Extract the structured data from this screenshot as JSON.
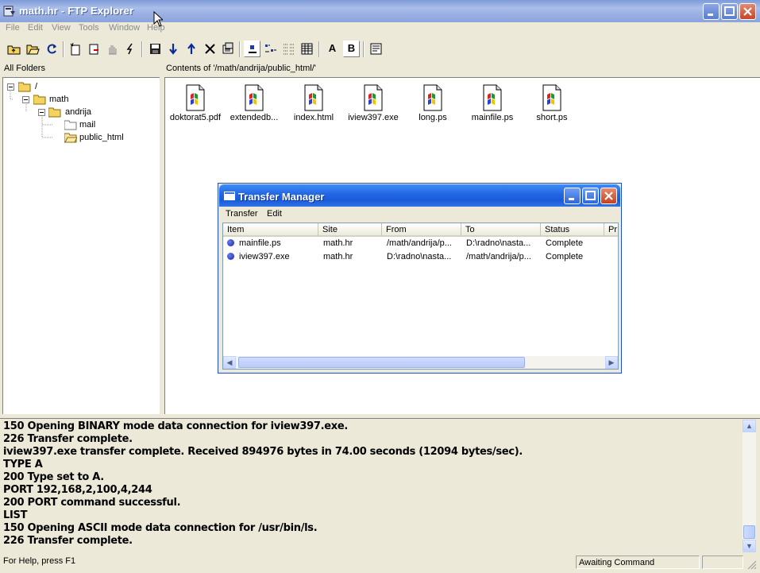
{
  "window": {
    "title": "math.hr - FTP Explorer",
    "controls": [
      "minimize",
      "maximize",
      "close"
    ]
  },
  "menubar": [
    "File",
    "Edit",
    "View",
    "Tools",
    "Window",
    "Help"
  ],
  "toolbar": {
    "buttons": [
      "up-folder-icon",
      "open-folder-icon",
      "refresh-icon",
      "new-folder-icon",
      "delete-file-icon",
      "hand-icon",
      "connect-icon",
      "save-icon",
      "download-icon",
      "upload-icon",
      "delete-icon",
      "properties-icon",
      "large-icons-view-icon",
      "small-icons-view-icon",
      "list-view-icon",
      "details-view-icon",
      "ascii-mode-icon",
      "binary-mode-icon",
      "log-window-icon"
    ],
    "ascii_label": "A",
    "binary_label": "B"
  },
  "folders_pane": {
    "header": "All Folders",
    "tree": [
      {
        "label": "/",
        "level": 0
      },
      {
        "label": "math",
        "level": 1
      },
      {
        "label": "andrija",
        "level": 2
      },
      {
        "label": "mail",
        "level": 3
      },
      {
        "label": "public_html",
        "level": 3
      }
    ]
  },
  "contents_pane": {
    "header": "Contents of '/math/andrija/public_html/'",
    "files": [
      "doktorat5.pdf",
      "extendedb...",
      "index.html",
      "iview397.exe",
      "long.ps",
      "mainfile.ps",
      "short.ps"
    ]
  },
  "transfer_manager": {
    "title": "Transfer Manager",
    "menu": [
      "Transfer",
      "Edit"
    ],
    "columns": [
      "Item",
      "Site",
      "From",
      "To",
      "Status",
      "Pr"
    ],
    "rows": [
      [
        "mainfile.ps",
        "math.hr",
        "/math/andrija/p...",
        "D:\\radno\\nasta...",
        "Complete"
      ],
      [
        "iview397.exe",
        "math.hr",
        "D:\\radno\\nasta...",
        "/math/andrija/p...",
        "Complete"
      ]
    ]
  },
  "log": [
    "150 Opening BINARY mode data connection for iview397.exe.",
    "226 Transfer complete.",
    "iview397.exe transfer complete.  Received 894976 bytes in 74.00 seconds (12094 bytes/sec).",
    "TYPE A",
    "200 Type set to A.",
    "PORT 192,168,2,100,4,244",
    "200 PORT command successful.",
    "LIST",
    "150 Opening ASCII mode data connection for /usr/bin/ls.",
    "226 Transfer complete."
  ],
  "statusbar": {
    "help": "For Help, press F1",
    "state": "Awaiting Command"
  },
  "colors": {
    "title_active": "#2266e3",
    "title_inactive": "#9db2e4",
    "face": "#ece9d8",
    "status_dot": "#2a36c8"
  }
}
